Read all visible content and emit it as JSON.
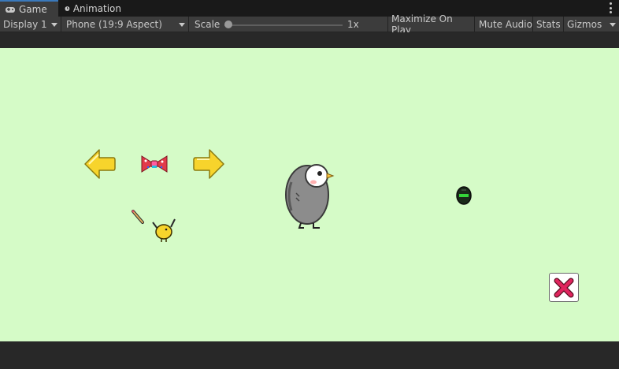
{
  "tabs": [
    {
      "label": "Game",
      "icon": "gamepad-icon",
      "active": true
    },
    {
      "label": "Animation",
      "icon": "clock-icon",
      "active": false
    }
  ],
  "toolbar": {
    "display": "Display 1",
    "aspect": "Phone (19:9 Aspect)",
    "scale_label": "Scale",
    "scale_value": "1x",
    "maximize": "Maximize On Play",
    "mute": "Mute Audio",
    "stats": "Stats",
    "gizmos": "Gizmos"
  },
  "colors": {
    "viewport_bg": "#d5fbc7",
    "arrow_yellow": "#f7d42c",
    "close_red": "#e0245e"
  },
  "scene": {
    "sprites": [
      "left-arrow-icon",
      "bow-icon",
      "right-arrow-icon",
      "penguin",
      "pencil-icon",
      "chick",
      "green-orb",
      "close-icon"
    ]
  }
}
